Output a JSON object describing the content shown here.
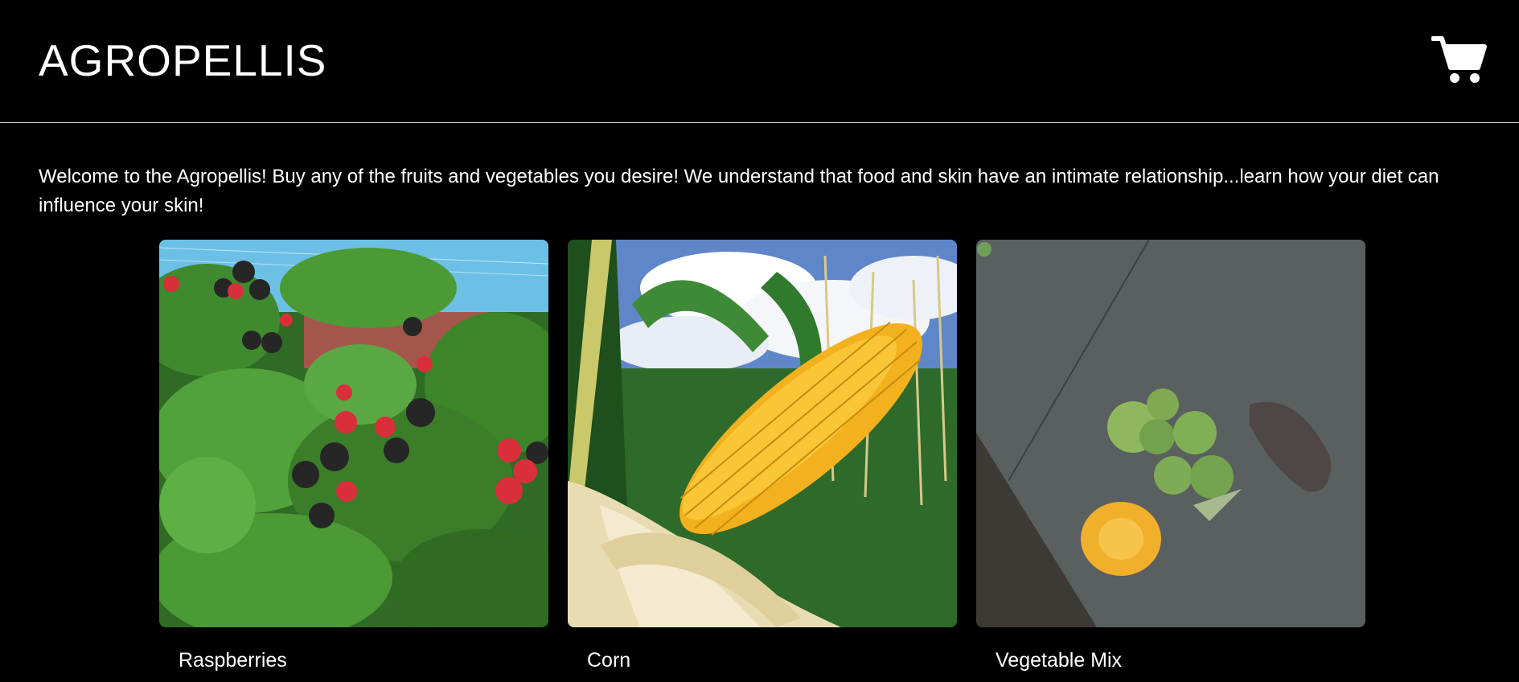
{
  "header": {
    "brand": "AGROPELLIS",
    "cart_icon": "shopping-cart-icon"
  },
  "intro": {
    "text": "Welcome to the Agropellis! Buy any of the fruits and vegetables you desire! We understand that food and skin have an intimate relationship...learn how your diet can influence your skin!"
  },
  "products": [
    {
      "name": "Raspberries",
      "image": "raspberry-bush-photo"
    },
    {
      "name": "Corn",
      "image": "corn-cob-photo"
    },
    {
      "name": "Vegetable Mix",
      "image": "vegetable-mix-photo"
    }
  ],
  "colors": {
    "background": "#000000",
    "text": "#ffffff",
    "divider": "#d9d9d9"
  }
}
